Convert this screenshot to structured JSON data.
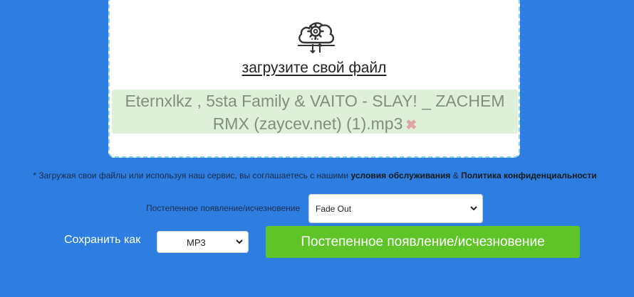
{
  "upload": {
    "icon": "cloud-settings-upload-icon",
    "link_text": "загрузите свой файл",
    "file_name": "Eternxlkz , 5sta Family & VAITO - SLAY! _ ZACHEM RMX (zaycev.net) (1).mp3",
    "remove_glyph": "✖"
  },
  "terms": {
    "prefix": "* Загружая свои файлы или используя наш сервис, вы соглашаетесь с нашими",
    "service_link": "условия обслуживания",
    "ampersand": "&",
    "privacy_link": "Политика конфиденциальности"
  },
  "fade": {
    "label": "Постепенное появление/исчезновение",
    "selected": "Fade Out"
  },
  "save": {
    "label": "Сохранить как",
    "format_selected": "MP3"
  },
  "action": {
    "button_label": "Постепенное появление/исчезновение"
  },
  "colors": {
    "background": "#2e7de0",
    "upload_border": "#7fd3ea",
    "file_chip": "#dff0d8",
    "button": "#5fc427"
  }
}
